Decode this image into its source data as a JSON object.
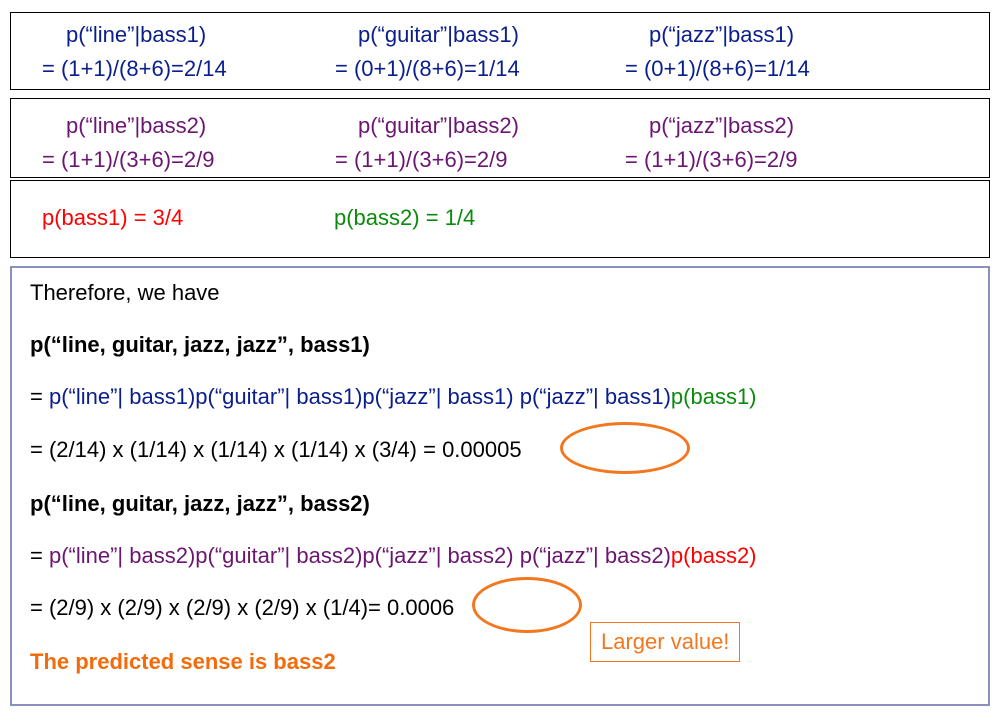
{
  "row1": {
    "col1": {
      "top": "p(“line”|bass1)",
      "bottom": "= (1+1)/(8+6)=2/14"
    },
    "col2": {
      "top": "p(“guitar”|bass1)",
      "bottom": "= (0+1)/(8+6)=1/14"
    },
    "col3": {
      "top": "p(“jazz”|bass1)",
      "bottom": "= (0+1)/(8+6)=1/14"
    }
  },
  "row2": {
    "col1": {
      "top": "p(“line”|bass2)",
      "bottom": "= (1+1)/(3+6)=2/9"
    },
    "col2": {
      "top": "p(“guitar”|bass2)",
      "bottom": "= (1+1)/(3+6)=2/9"
    },
    "col3": {
      "top": "p(“jazz”|bass2)",
      "bottom": "= (1+1)/(3+6)=2/9"
    }
  },
  "priors": {
    "bass1": "p(bass1) = 3/4",
    "bass2": "p(bass2) = 1/4"
  },
  "main": {
    "intro": "Therefore, we have",
    "h1": "p(“line, guitar, jazz, jazz”, bass1)",
    "eq1_prefix": " = ",
    "eq1_body": "p(“line”| bass1)p(“guitar”| bass1)p(“jazz”| bass1) p(“jazz”| bass1)",
    "eq1_prior": "p(bass1)",
    "calc1": " = (2/14) x (1/14) x (1/14) x (1/14) x (3/4) = ",
    "result1": "0.00005",
    "h2": "p(“line, guitar, jazz, jazz”, bass2)",
    "eq2_prefix": "= ",
    "eq2_body": "p(“line”| bass2)p(“guitar”| bass2)p(“jazz”| bass2) p(“jazz”| bass2)",
    "eq2_prior": "p(bass2)",
    "calc2": "= (2/9) x (2/9) x (2/9) x (2/9) x (1/4)= ",
    "result2": "0.0006",
    "conclusion": "The predicted sense is bass2",
    "callout": "Larger value!"
  },
  "colors": {
    "blue": "#0a1e8c",
    "purple": "#6b1670",
    "red": "#ff0000",
    "green": "#0c8a0c",
    "orange": "#f26c0c"
  }
}
